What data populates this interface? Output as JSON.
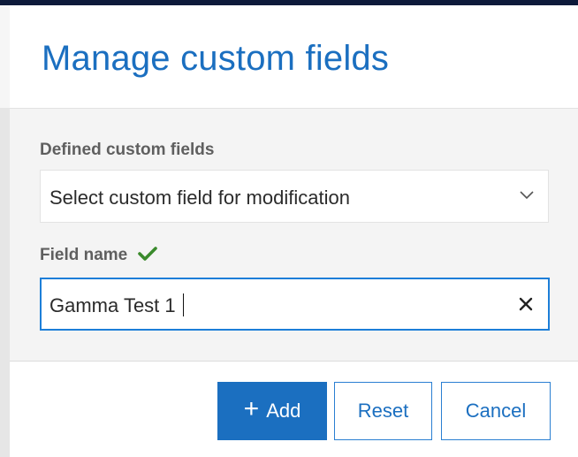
{
  "dialog": {
    "title": "Manage custom fields"
  },
  "defined_fields": {
    "label": "Defined custom fields",
    "selected_value": "Select custom field for modification",
    "icon": "chevron-down-icon"
  },
  "field_name": {
    "label": "Field name",
    "value": "Gamma Test 1",
    "valid_icon": "checkmark-icon",
    "clear_icon": "close-icon"
  },
  "buttons": {
    "add_label": "Add",
    "add_icon": "plus-icon",
    "reset_label": "Reset",
    "cancel_label": "Cancel"
  },
  "colors": {
    "accent": "#1b6fc0",
    "valid": "#3a8a2c",
    "input_focus_border": "#1d7ed8"
  }
}
